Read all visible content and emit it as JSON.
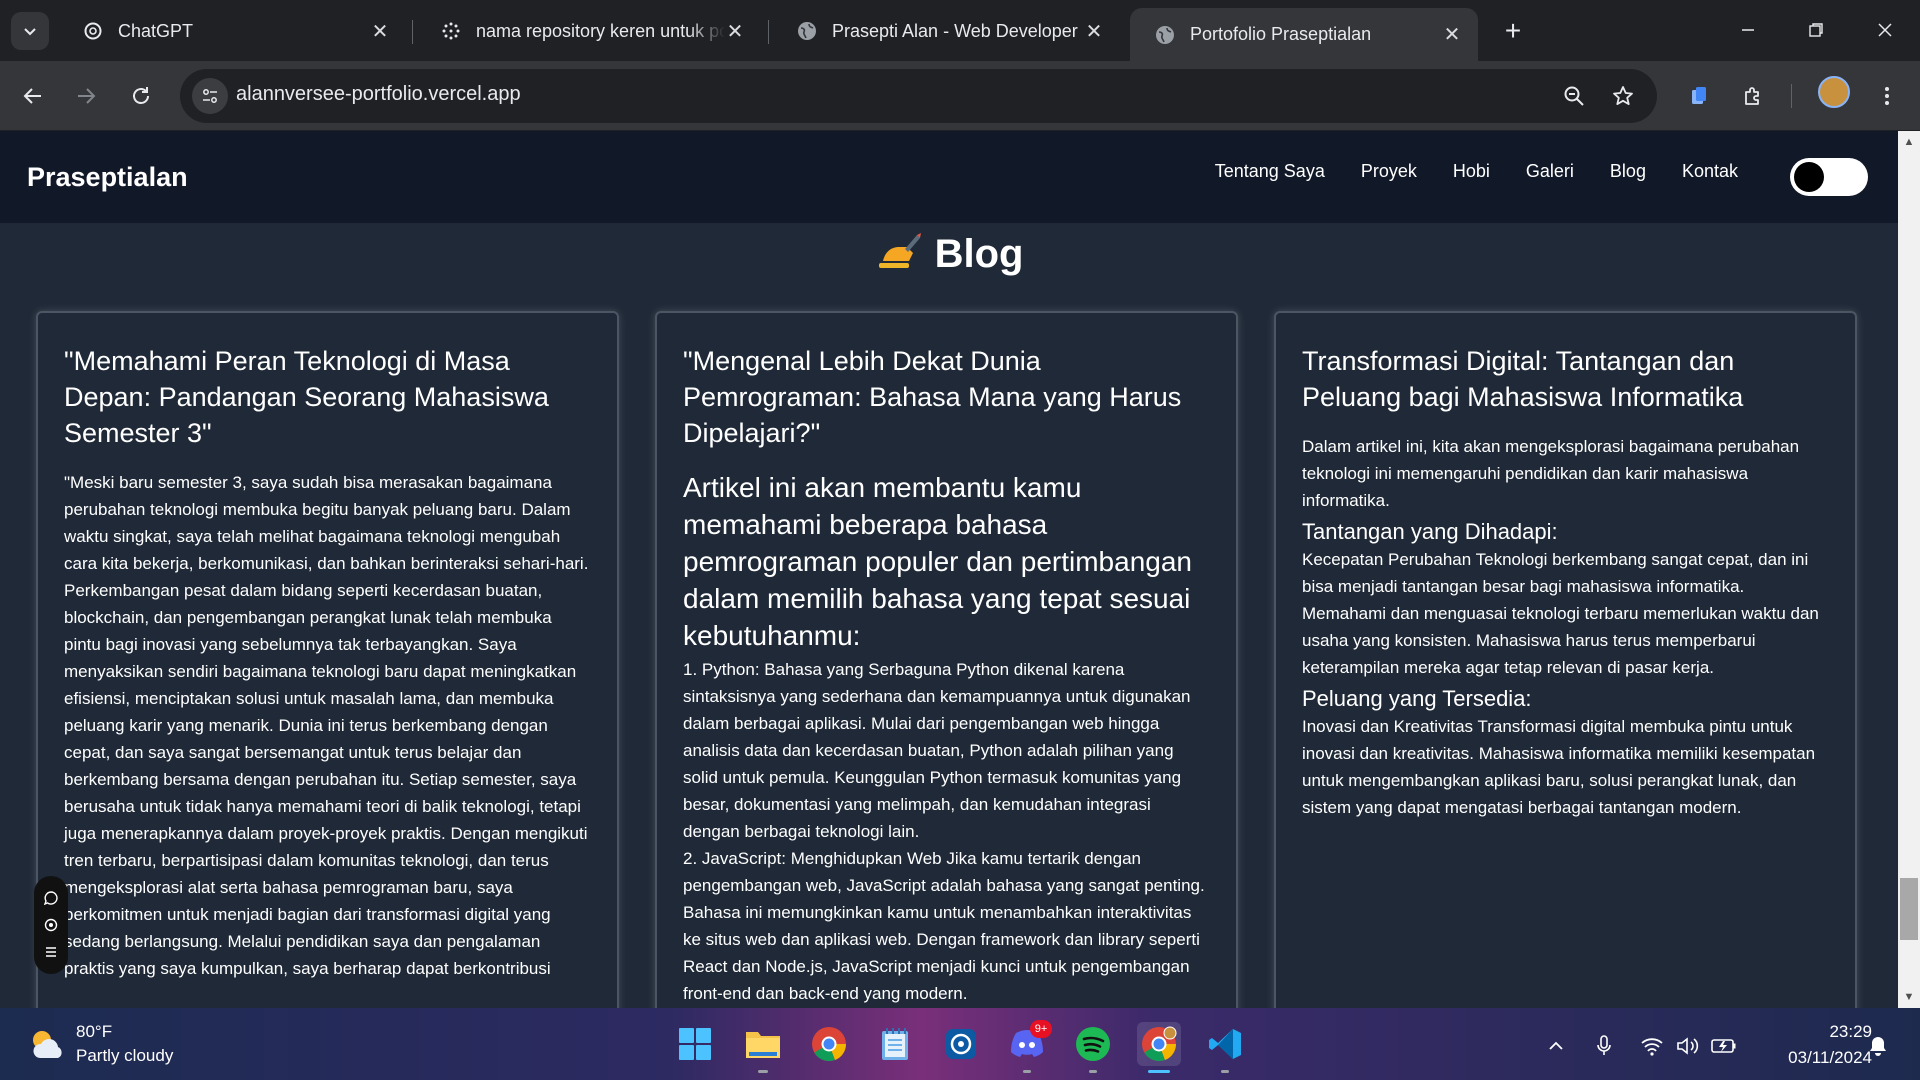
{
  "browser": {
    "tabs": [
      {
        "title": "ChatGPT",
        "icon": "chatgpt-icon"
      },
      {
        "title": "nama repository keren untuk portofolio",
        "icon": "perplexity-icon"
      },
      {
        "title": "Prasepti Alan - Web Developer",
        "icon": "globe-icon"
      },
      {
        "title": "Portofolio Praseptialan",
        "icon": "globe-icon"
      }
    ],
    "active_tab": 3,
    "url": "alannversee-portfolio.vercel.app"
  },
  "site": {
    "brand": "Praseptialan",
    "nav": [
      "Tentang Saya",
      "Proyek",
      "Hobi",
      "Galeri",
      "Blog",
      "Kontak"
    ],
    "heading": "Blog",
    "heading_emoji": "writing-hand-emoji",
    "dark_mode_toggle": "on"
  },
  "posts": [
    {
      "title": "\"Memahami Peran Teknologi di Masa Depan: Pandangan Seorang Mahasiswa Semester 3\"",
      "body": "\"Meski baru semester 3, saya sudah bisa merasakan bagaimana perubahan teknologi membuka begitu banyak peluang baru. Dalam waktu singkat, saya telah melihat bagaimana teknologi mengubah cara kita bekerja, berkomunikasi, dan bahkan berinteraksi sehari-hari. Perkembangan pesat dalam bidang seperti kecerdasan buatan, blockchain, dan pengembangan perangkat lunak telah membuka pintu bagi inovasi yang sebelumnya tak terbayangkan. Saya menyaksikan sendiri bagaimana teknologi baru dapat meningkatkan efisiensi, menciptakan solusi untuk masalah lama, dan membuka peluang karir yang menarik. Dunia ini terus berkembang dengan cepat, dan saya sangat bersemangat untuk terus belajar dan berkembang bersama dengan perubahan itu. Setiap semester, saya berusaha untuk tidak hanya memahami teori di balik teknologi, tetapi juga menerapkannya dalam proyek-proyek praktis. Dengan mengikuti tren terbaru, berpartisipasi dalam komunitas teknologi, dan terus mengeksplorasi alat serta bahasa pemrograman baru, saya berkomitmen untuk menjadi bagian dari transformasi digital yang sedang berlangsung. Melalui pendidikan saya dan pengalaman praktis yang saya kumpulkan, saya berharap dapat berkontribusi"
    },
    {
      "title": "\"Mengenal Lebih Dekat Dunia Pemrograman: Bahasa Mana yang Harus Dipelajari?\"",
      "lead": "Artikel ini akan membantu kamu memahami beberapa bahasa pemrograman populer dan pertimbangan dalam memilih bahasa yang tepat sesuai kebutuhanmu:",
      "item1": "1. Python: Bahasa yang Serbaguna Python dikenal karena sintaksisnya yang sederhana dan kemampuannya untuk digunakan dalam berbagai aplikasi. Mulai dari pengembangan web hingga analisis data dan kecerdasan buatan, Python adalah pilihan yang solid untuk pemula. Keunggulan Python termasuk komunitas yang besar, dokumentasi yang melimpah, dan kemudahan integrasi dengan berbagai teknologi lain.",
      "item2": "2. JavaScript: Menghidupkan Web Jika kamu tertarik dengan pengembangan web, JavaScript adalah bahasa yang sangat penting. Bahasa ini memungkinkan kamu untuk menambahkan interaktivitas ke situs web dan aplikasi web. Dengan framework dan library seperti React dan Node.js, JavaScript menjadi kunci untuk pengembangan front-end dan back-end yang modern."
    },
    {
      "title": "Transformasi Digital: Tantangan dan Peluang bagi Mahasiswa Informatika",
      "intro": "Dalam artikel ini, kita akan mengeksplorasi bagaimana perubahan teknologi ini memengaruhi pendidikan dan karir mahasiswa informatika.",
      "sub1": "Tantangan yang Dihadapi:",
      "text1": "Kecepatan Perubahan Teknologi berkembang sangat cepat, dan ini bisa menjadi tantangan besar bagi mahasiswa informatika. Memahami dan menguasai teknologi terbaru memerlukan waktu dan usaha yang konsisten. Mahasiswa harus terus memperbarui keterampilan mereka agar tetap relevan di pasar kerja.",
      "sub2": "Peluang yang Tersedia:",
      "text2": "Inovasi dan Kreativitas Transformasi digital membuka pintu untuk inovasi dan kreativitas. Mahasiswa informatika memiliki kesempatan untuk mengembangkan aplikasi baru, solusi perangkat lunak, dan sistem yang dapat mengatasi berbagai tantangan modern."
    }
  ],
  "taskbar": {
    "temperature": "80°F",
    "weather": "Partly cloudy",
    "discord_badge": "9+",
    "time": "23:29",
    "date": "03/11/2024",
    "apps": [
      "start-icon",
      "file-explorer-icon",
      "chrome-icon",
      "notepad-icon",
      "snipping-tool-icon",
      "discord-icon",
      "spotify-icon",
      "chrome-profile-icon",
      "vscode-icon"
    ]
  }
}
